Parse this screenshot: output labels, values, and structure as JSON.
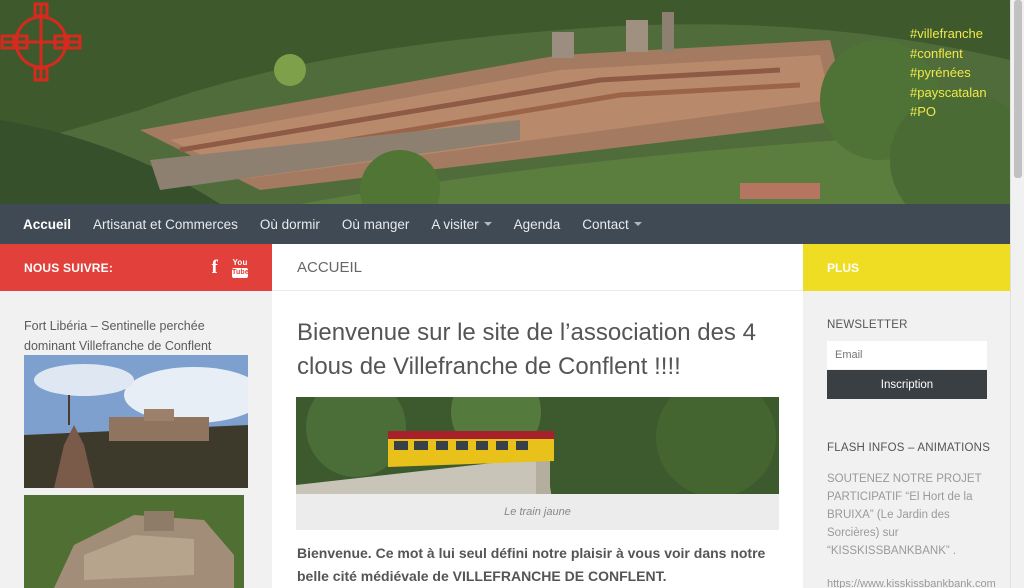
{
  "hero": {
    "hashtags": [
      "#villefranche",
      "#conflent",
      "#pyrénées",
      "#payscatalan",
      "#PO"
    ]
  },
  "nav": {
    "items": [
      {
        "label": "Accueil",
        "active": true,
        "dropdown": false
      },
      {
        "label": "Artisanat et Commerces",
        "active": false,
        "dropdown": false
      },
      {
        "label": "Où dormir",
        "active": false,
        "dropdown": false
      },
      {
        "label": "Où manger",
        "active": false,
        "dropdown": false
      },
      {
        "label": "A visiter",
        "active": false,
        "dropdown": true
      },
      {
        "label": "Agenda",
        "active": false,
        "dropdown": false
      },
      {
        "label": "Contact",
        "active": false,
        "dropdown": true
      }
    ]
  },
  "left": {
    "header": "NOUS SUIVRE:",
    "social_icons": [
      "facebook-icon",
      "youtube-icon"
    ],
    "youtube_top": "You",
    "youtube_bottom": "Tube",
    "facebook_glyph": "f",
    "caption": "Fort Libéria – Sentinelle perchée dominant Villefranche de Conflent"
  },
  "main": {
    "header": "ACCUEIL",
    "title": "Bienvenue sur le site de l’association des 4 clous de Villefranche de Conflent !!!!",
    "image_caption": "Le train jaune",
    "intro": "Bienvenue. Ce mot à lui seul défini notre plaisir à vous voir dans notre belle cité médiévale de VILLEFRANCHE DE CONFLENT."
  },
  "right": {
    "header": "PLUS",
    "newsletter_label": "NEWSLETTER",
    "email_placeholder": "Email",
    "subscribe_label": "Inscription",
    "flash_label": "FLASH INFOS – ANIMATIONS",
    "flash_text": "SOUTENEZ NOTRE PROJET PARTICIPATIF “El Hort de la BRUIXA” (Le Jardin des Sorcières) sur “KISSKISSBANKBANK” .",
    "flash_url": "https://www.kisskissbankbank.com"
  },
  "colors": {
    "nav_bg": "#3f4a55",
    "left_accent": "#e2403a",
    "right_accent": "#eedd22",
    "hashtag": "#f0e94a",
    "logo": "#d42a20"
  }
}
